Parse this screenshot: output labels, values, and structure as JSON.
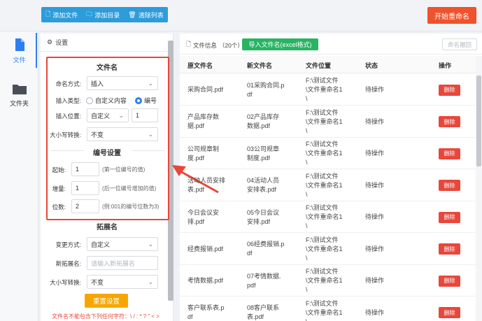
{
  "toolbar": {
    "add_file": "添加文件",
    "add_dir": "添加目录",
    "clear_list": "清除列表",
    "start_rename": "开始重命名"
  },
  "nav": [
    {
      "label": "文件",
      "icon": "file-icon",
      "active": true
    },
    {
      "label": "文件夹",
      "icon": "folder-icon",
      "active": false
    }
  ],
  "settings": {
    "title": "设置",
    "filename": {
      "section_title": "文件名",
      "naming_mode_label": "命名方式:",
      "naming_mode_value": "插入",
      "insert_type_label": "插入类型:",
      "insert_type_options": [
        "自定义内容",
        "编号"
      ],
      "insert_type_selected": "编号",
      "insert_pos_label": "插入位置:",
      "insert_pos_value": "自定义",
      "insert_pos_number": "1",
      "case_label": "大小写转换:",
      "case_value": "不变"
    },
    "numbering": {
      "section_title": "编号设置",
      "start_label": "起始:",
      "start_value": "1",
      "start_hint": "(第一位编号的值)",
      "step_label": "增量:",
      "step_value": "1",
      "step_hint": "(后一位编号增加的值)",
      "digits_label": "位数:",
      "digits_value": "2",
      "digits_hint": "(例:001的编号位数为3)"
    },
    "extension": {
      "section_title": "拓展名",
      "change_mode_label": "变更方式:",
      "change_mode_value": "自定义",
      "new_ext_label": "新拓展名:",
      "new_ext_placeholder": "请输入新拓展名",
      "case_label": "大小写转换:",
      "case_value": "不变"
    },
    "reset_button": "重置设置",
    "warning": "文件名不能包含下列任何字符：\\ / : * ? \" < >"
  },
  "file_info": {
    "label": "文件信息",
    "count": "（20个）",
    "import_button": "导入文件名(excel格式)",
    "undo_button": "命名撤回"
  },
  "table": {
    "headers": [
      "原文件名",
      "新文件名",
      "文件位置",
      "状态",
      "操作"
    ],
    "rows": [
      {
        "orig": [
          "采购合同.pdf"
        ],
        "new": [
          "01采购合同.p",
          "df"
        ],
        "loc": [
          "F:\\测试文件",
          "\\文件重命名1",
          "\\"
        ],
        "status": "待操作",
        "action": "删除"
      },
      {
        "orig": [
          "产品库存数",
          "据.pdf"
        ],
        "new": [
          "02产品库存",
          "数据.pdf"
        ],
        "loc": [
          "F:\\测试文件",
          "\\文件重命名1",
          "\\"
        ],
        "status": "待操作",
        "action": "删除"
      },
      {
        "orig": [
          "公司规章制",
          "度.pdf"
        ],
        "new": [
          "03公司规章",
          "制度.pdf"
        ],
        "loc": [
          "F:\\测试文件",
          "\\文件重命名1",
          "\\"
        ],
        "status": "待操作",
        "action": "删除"
      },
      {
        "orig": [
          "活动人员安排",
          "表.pdf"
        ],
        "new": [
          "04活动人员",
          "安排表.pdf"
        ],
        "loc": [
          "F:\\测试文件",
          "\\文件重命名1",
          "\\"
        ],
        "status": "待操作",
        "action": "删除"
      },
      {
        "orig": [
          "今日会议安",
          "排.pdf"
        ],
        "new": [
          "05今日会议",
          "安排.pdf"
        ],
        "loc": [
          "F:\\测试文件",
          "\\文件重命名1",
          "\\"
        ],
        "status": "待操作",
        "action": "删除"
      },
      {
        "orig": [
          "经费报销.pdf"
        ],
        "new": [
          "06经费报销.p",
          "df"
        ],
        "loc": [
          "F:\\测试文件",
          "\\文件重命名1",
          "\\"
        ],
        "status": "待操作",
        "action": "删除"
      },
      {
        "orig": [
          "考情数据.pdf"
        ],
        "new": [
          "07考情数据.",
          "pdf"
        ],
        "loc": [
          "F:\\测试文件",
          "\\文件重命名1",
          "\\"
        ],
        "status": "待操作",
        "action": "删除"
      },
      {
        "orig": [
          "客户联系表.p",
          "df"
        ],
        "new": [
          "08客户联系",
          "表.pdf"
        ],
        "loc": [
          "F:\\测试文件",
          "\\文件重命名1",
          "\\"
        ],
        "status": "待操作",
        "action": "删除"
      }
    ]
  },
  "colors": {
    "accent": "#2d9cdb",
    "danger": "#e8473b",
    "success": "#28b463",
    "warning": "#f7a600",
    "start": "#f0522b"
  }
}
